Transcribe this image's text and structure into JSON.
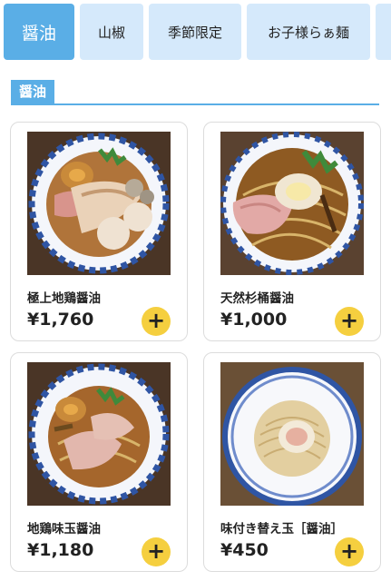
{
  "tabs": [
    {
      "label": "醤油",
      "active": true
    },
    {
      "label": "山椒",
      "active": false
    },
    {
      "label": "季節限定",
      "active": false
    },
    {
      "label": "お子様らぁ麺",
      "active": false
    },
    {
      "label": "",
      "active": false
    }
  ],
  "section": {
    "title": "醤油"
  },
  "items": [
    {
      "name": "極上地鶏醤油",
      "price": "¥1,760",
      "image": "ramen-bowl-photo"
    },
    {
      "name": "天然杉桶醤油",
      "price": "¥1,000",
      "image": "ramen-bowl-photo"
    },
    {
      "name": "地鶏味玉醤油",
      "price": "¥1,180",
      "image": "ramen-bowl-photo"
    },
    {
      "name": "味付き替え玉［醤油］",
      "price": "¥450",
      "image": "noodle-bowl-photo"
    }
  ],
  "add_icon": "plus-icon",
  "colors": {
    "accent": "#5aaee6",
    "tab_bg": "#d5e9fb",
    "add_button": "#f5cf3f"
  }
}
